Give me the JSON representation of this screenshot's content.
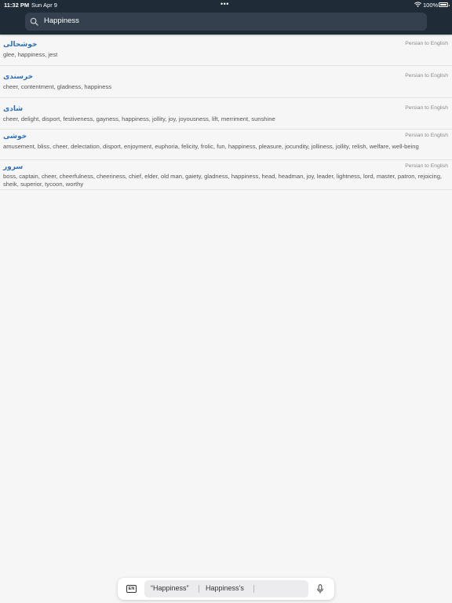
{
  "status_bar": {
    "time": "11:32 PM",
    "date": "Sun Apr 9",
    "center_dots": "•••",
    "battery": "100%"
  },
  "search": {
    "value": "Happiness",
    "icon": "search-icon"
  },
  "results": [
    {
      "term": "خوشحالی",
      "source": "Persian to English",
      "translation": "glee, happiness, jest"
    },
    {
      "term": "خرسندی",
      "source": "Persian to English",
      "translation": "cheer, contentment, gladness, happiness"
    },
    {
      "term": "شادی",
      "source": "Persian to English",
      "translation": "cheer, delight, disport, festiveness, gayness, happiness, jollity, joy, joyousness, lift, merriment, sunshine"
    },
    {
      "term": "خوشی",
      "source": "Persian to English",
      "translation": "amusement, bliss, cheer, delectation, disport, enjoyment, euphoria, felicity, frolic, fun, happiness, pleasure, jocundity, jolliness, jollity, relish, welfare, well-being"
    },
    {
      "term": "سرور",
      "source": "Persian to English",
      "translation": "boss, captain, cheer, cheerfulness, cheeriness, chief, elder, old man, gaiety, gladness, happiness, head, headman, joy, leader, lightness, lord, master, patron, rejoicing, sheik, superior, tycoon, worthy"
    }
  ],
  "keyboard": {
    "language_key": "EN",
    "suggestions": [
      "“Happiness”",
      "Happiness’s"
    ]
  },
  "colors": {
    "header_bg": "#1f2b37",
    "search_bg": "#34404d",
    "term_color": "#2f6fb5",
    "page_bg": "#f6f6f7"
  }
}
